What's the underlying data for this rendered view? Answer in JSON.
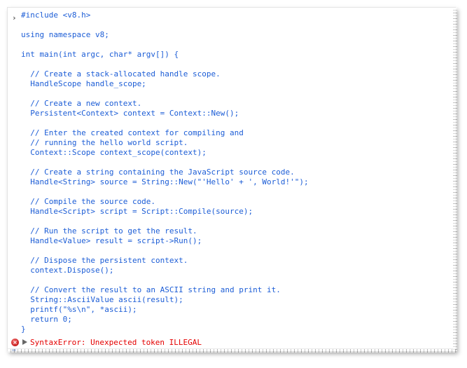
{
  "console": {
    "input_lines": [
      "#include <v8.h>",
      "",
      "using namespace v8;",
      "",
      "int main(int argc, char* argv[]) {",
      "",
      "  // Create a stack-allocated handle scope.",
      "  HandleScope handle_scope;",
      "",
      "  // Create a new context.",
      "  Persistent<Context> context = Context::New();",
      "",
      "  // Enter the created context for compiling and",
      "  // running the hello world script.",
      "  Context::Scope context_scope(context);",
      "",
      "  // Create a string containing the JavaScript source code.",
      "  Handle<String> source = String::New(\"'Hello' + ', World!'\");",
      "",
      "  // Compile the source code.",
      "  Handle<Script> script = Script::Compile(source);",
      "",
      "  // Run the script to get the result.",
      "  Handle<Value> result = script->Run();",
      "",
      "  // Dispose the persistent context.",
      "  context.Dispose();",
      "",
      "  // Convert the result to an ASCII string and print it.",
      "  String::AsciiValue ascii(result);",
      "  printf(\"%s\\n\", *ascii);",
      "  return 0;",
      "}"
    ],
    "prompt_glyph": "›",
    "error": {
      "icon": "error-circle-icon",
      "icon_glyph": "×",
      "expand_icon": "disclosure-triangle-icon",
      "message": "SyntaxError: Unexpected token ILLEGAL"
    },
    "colors": {
      "input_text": "#1c5dd6",
      "error_text": "#e40000"
    }
  }
}
